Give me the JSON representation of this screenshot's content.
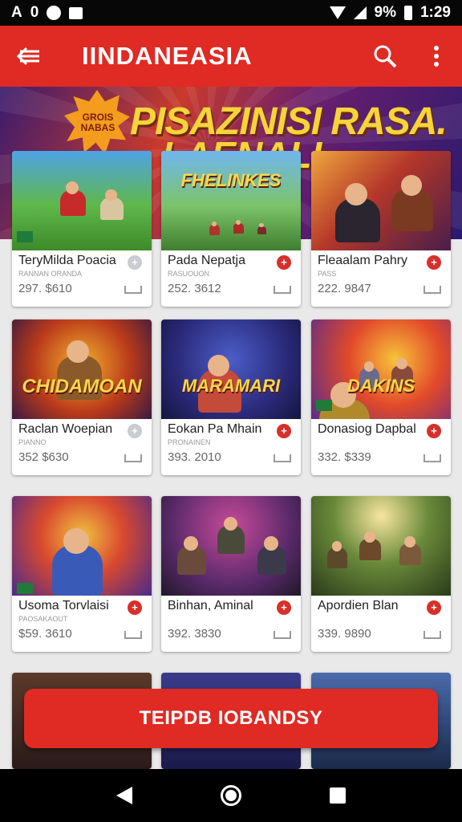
{
  "status_bar": {
    "left_text": "A",
    "left_digit": "0",
    "battery_percent": "9%",
    "time": "1:29"
  },
  "app_bar": {
    "title": "IINDANEASIA"
  },
  "banner": {
    "headline_1": "PISAZINISI RASA.",
    "headline_2": "LAENALI",
    "burst_text": "GROIS NABAS"
  },
  "games": [
    {
      "title": "TeryMilda Poacia",
      "sub": "RANNAN ORANDA",
      "price": "297. $610",
      "art_caption": ""
    },
    {
      "title": "Pada Nepatja",
      "sub": "RASUOUON",
      "price": "252. 3612",
      "art_caption": "FHELINKES"
    },
    {
      "title": "Fleaalam Pahry",
      "sub": "PASS",
      "price": "222. 9847",
      "art_caption": ""
    },
    {
      "title": "Raclan Woepian",
      "sub": "PIANNO",
      "price": "352 $630",
      "art_caption": "CHIDAMOAN"
    },
    {
      "title": "Eokan Pa Mhain",
      "sub": "PRONAINEN",
      "price": "393. 2010",
      "art_caption": "MARAMARI"
    },
    {
      "title": "Donasiog Dapbal",
      "sub": "",
      "price": "332. $339",
      "art_caption": "DAKINS"
    },
    {
      "title": "Usoma Torvlaisi",
      "sub": "PAOSAKAOUT",
      "price": "$59. 3610",
      "art_caption": ""
    },
    {
      "title": "Binhan, Aminal",
      "sub": "",
      "price": "392. 3830",
      "art_caption": ""
    },
    {
      "title": "Apordien Blan",
      "sub": "",
      "price": "339. 9890",
      "art_caption": ""
    }
  ],
  "cta": {
    "label": "TEIPDB IOBANDSY"
  },
  "colors": {
    "primary": "#e02a24",
    "gold": "#f6d43a"
  },
  "icons": [
    "back-arrow-icon",
    "search-icon",
    "more-vert-icon",
    "download-icon",
    "nav-back-icon",
    "nav-home-icon",
    "nav-recents-icon"
  ]
}
